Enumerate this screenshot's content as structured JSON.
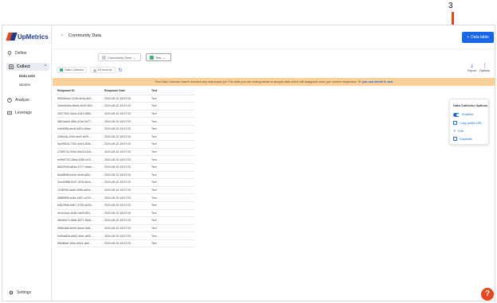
{
  "annotation": {
    "number": "3"
  },
  "brand": {
    "name": "UpMetrics"
  },
  "sidebar": {
    "define": "Define",
    "collect": "Collect",
    "data_sets": "Data sets",
    "stories": "Stories",
    "analyze": "Analyze",
    "leverage": "Leverage",
    "settings": "Settings"
  },
  "header": {
    "title": "Community Data",
    "data_table_button": "Data table"
  },
  "tabs": {
    "community": "Community Data",
    "test": "Test"
  },
  "toolbar": {
    "data_collector": "Data Collector",
    "records": "19 records"
  },
  "banner": {
    "text": "This Data Collector hasn't received any responses yet. The data you are seeing below is sample data which will disappear once you receive responses. Or",
    "link": "you can delete it now."
  },
  "table": {
    "headers": [
      "Response ID",
      "Response Date",
      "Text"
    ],
    "rows": [
      [
        "5f55d0ea2-2c9d-4b4a-8d2...",
        "2024-08-15 18:57:20",
        "Text"
      ],
      [
        "2a9ed94ee-8beb-4b45-800...",
        "2024-08-15 18:57:20",
        "Text"
      ],
      [
        "33f77942-3a2a-4343-86f5...",
        "2024-08-15 18:57:20",
        "Text"
      ],
      [
        "3801adc6-3f5e-414e-9e77...",
        "2024-08-15 18:57:20",
        "Text"
      ],
      [
        "e4fd09f8-aec8-4d91-b6de...",
        "2024-08-15 18:57:20",
        "Text"
      ],
      [
        "226ec5c-24f4-4ed7-bf29-...",
        "2024-08-15 18:57:20",
        "Text"
      ],
      [
        "0a295f16-77b2-49e3-82fe...",
        "2024-08-15 18:57:20",
        "Text"
      ],
      [
        "c755f742-92b4-49e3-b106...",
        "2024-08-15 18:57:20",
        "Text"
      ],
      [
        "ee5b9732-28ed-4366-a76...",
        "2024-08-15 18:57:20",
        "Text"
      ],
      [
        "652091bf-a53a-4717-9aa9-...",
        "2024-08-15 18:57:20",
        "Text"
      ],
      [
        "5dc5808f-b4cb-4ee6-af2e...",
        "2024-08-15 18:57:20",
        "Text"
      ],
      [
        "3ced2988-0c07-4f15-a5ce...",
        "2024-08-15 18:57:20",
        "Text"
      ],
      [
        "1198936-9ad0-455b-ad2a...",
        "2024-08-15 18:57:20",
        "Text"
      ],
      [
        "386f9859-a1fd-4487-a229-...",
        "2024-08-15 18:57:20",
        "Text"
      ],
      [
        "b4619fdd-ddb7-4745-ab34...",
        "2024-08-15 18:57:20",
        "Text"
      ],
      [
        "4e1c1bcc-6186-4a09-891...",
        "2024-08-15 18:57:20",
        "Text"
      ],
      [
        "06bd2e71-dfa6-4877-86d1...",
        "2024-08-15 18:57:20",
        "Text"
      ],
      [
        "3f9bea8d-bb9b-4bea-9c8f...",
        "2024-08-15 18:57:20",
        "Text"
      ],
      [
        "0e0ba82b-6d92-4fee-aef3-...",
        "2024-08-15 18:57:20",
        "Text"
      ],
      [
        "f9646fa0-10be-44e4-ab6...",
        "2024-08-15 18:57:20",
        "Text"
      ]
    ]
  },
  "actions": {
    "export": "Export",
    "options": "Options"
  },
  "options_popup": {
    "title": "Data Collector Options",
    "enabled": "Enabled",
    "copy_url": "Copy public URL",
    "edit": "Edit",
    "duplicate": "Duplicate"
  },
  "help": {
    "label": "?"
  },
  "colors": {
    "brand_orange": "#e8461f",
    "brand_navy": "#1e3a8a",
    "primary_blue": "#1766e6",
    "banner": "#f9cf9a"
  }
}
